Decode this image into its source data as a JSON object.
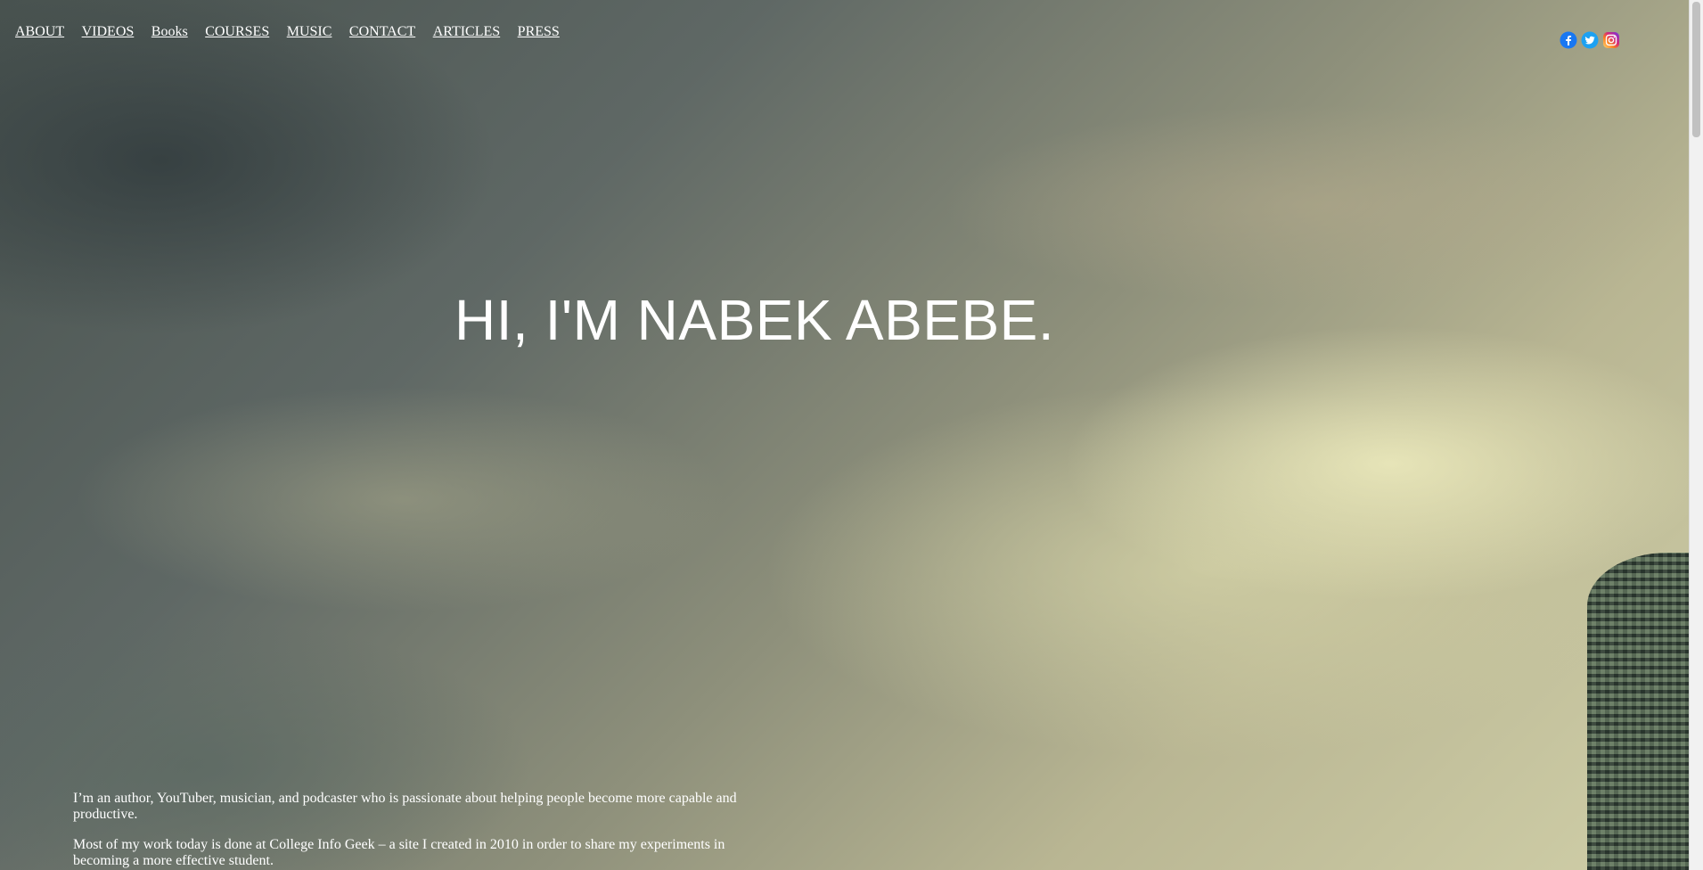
{
  "nav": {
    "items": [
      {
        "label": "ABOUT"
      },
      {
        "label": "VIDEOS"
      },
      {
        "label": "Books"
      },
      {
        "label": "COURSES"
      },
      {
        "label": "MUSIC"
      },
      {
        "label": "CONTACT"
      },
      {
        "label": "ARTICLES"
      },
      {
        "label": "PRESS"
      }
    ]
  },
  "social": {
    "icons": [
      "facebook-icon",
      "twitter-icon",
      "instagram-icon"
    ],
    "colors": {
      "facebook": "#1877f2",
      "twitter": "#1da1f2",
      "instagram": "#e1306c"
    }
  },
  "hero": {
    "title": "HI, I'M NABEK ABEBE."
  },
  "intro": {
    "paragraph_1": "I’m an author, YouTuber, musician, and podcaster who is passionate about helping people become more capable and productive.",
    "paragraph_2": "Most of my work today is done at College Info Geek – a site I created in 2010 in order to share my experiments in becoming a more effective student."
  }
}
